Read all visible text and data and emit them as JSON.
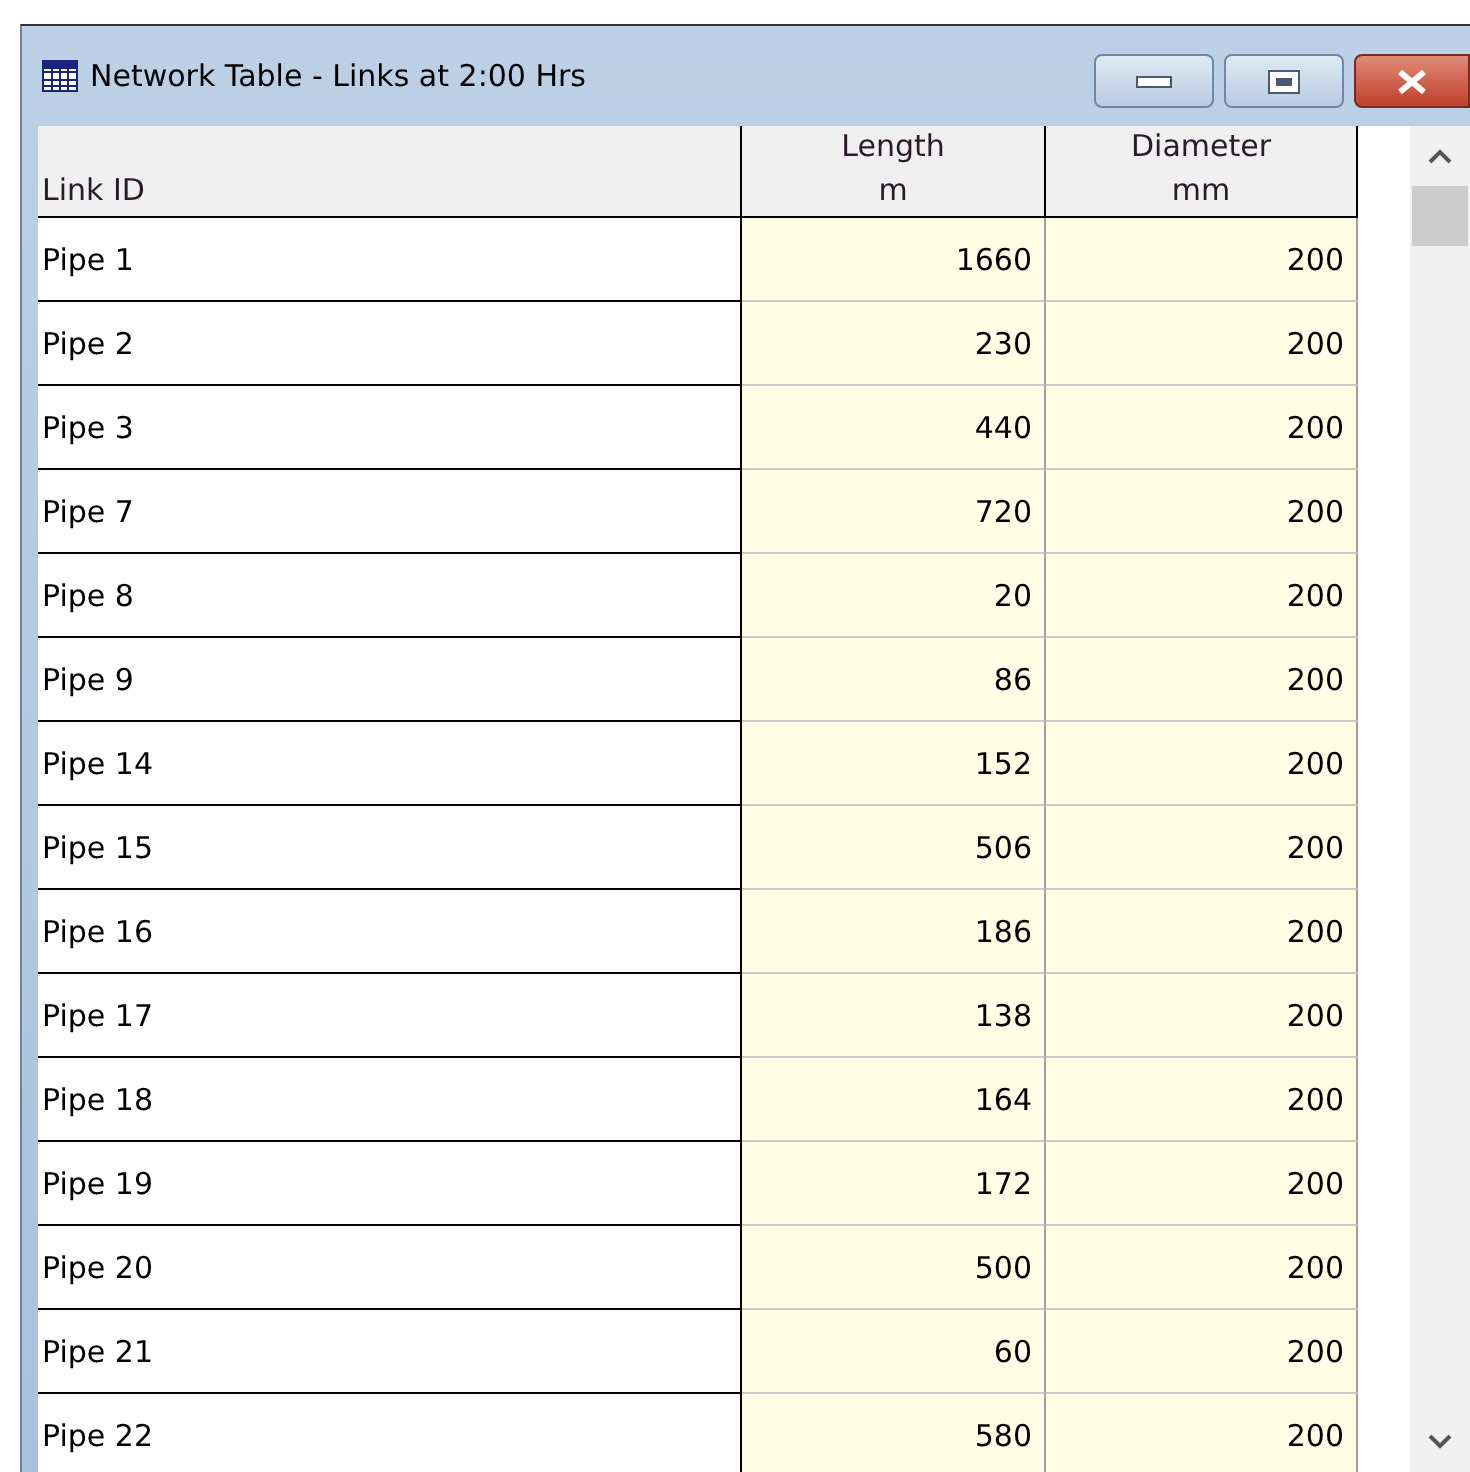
{
  "window": {
    "title": "Network Table - Links at 2:00 Hrs"
  },
  "table": {
    "columns": [
      {
        "lines": [
          "Link ID"
        ]
      },
      {
        "lines": [
          "Length",
          "m"
        ]
      },
      {
        "lines": [
          "Diameter",
          "mm"
        ]
      }
    ],
    "rows": [
      [
        "Pipe 1",
        "1660",
        "200"
      ],
      [
        "Pipe 2",
        "230",
        "200"
      ],
      [
        "Pipe 3",
        "440",
        "200"
      ],
      [
        "Pipe 7",
        "720",
        "200"
      ],
      [
        "Pipe 8",
        "20",
        "200"
      ],
      [
        "Pipe 9",
        "86",
        "200"
      ],
      [
        "Pipe 14",
        "152",
        "200"
      ],
      [
        "Pipe 15",
        "506",
        "200"
      ],
      [
        "Pipe 16",
        "186",
        "200"
      ],
      [
        "Pipe 17",
        "138",
        "200"
      ],
      [
        "Pipe 18",
        "164",
        "200"
      ],
      [
        "Pipe 19",
        "172",
        "200"
      ],
      [
        "Pipe 20",
        "500",
        "200"
      ],
      [
        "Pipe 21",
        "60",
        "200"
      ],
      [
        "Pipe 22",
        "580",
        "200"
      ]
    ]
  }
}
